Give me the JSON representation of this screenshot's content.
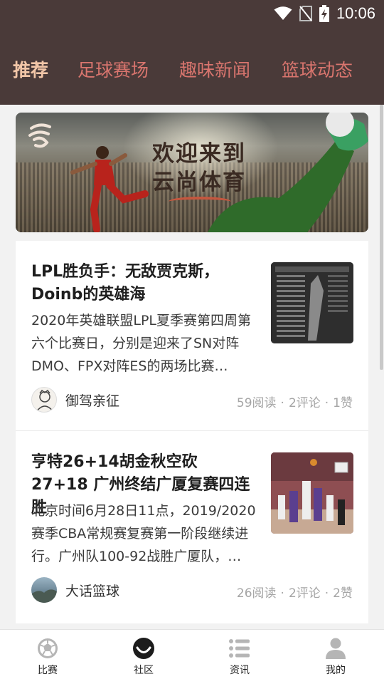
{
  "status": {
    "time": "10:06",
    "icons": [
      "wifi-icon",
      "no-sim-icon",
      "battery-charging-icon"
    ]
  },
  "tabs": [
    {
      "label": "推荐",
      "active": true
    },
    {
      "label": "足球赛场",
      "active": false
    },
    {
      "label": "趣味新闻",
      "active": false
    },
    {
      "label": "篮球动态",
      "active": false
    }
  ],
  "banner": {
    "line1": "欢迎来到",
    "line2": "云尚体育"
  },
  "articles": [
    {
      "title": "LPL胜负手：无敌贾克斯，Doinb的英雄海",
      "summary": "2020年英雄联盟LPL夏季赛第四周第六个比赛日，分别是迎来了SN对阵DMO、FPX对阵ES的两场比赛…",
      "author": "御驾亲征",
      "reads": "59阅读",
      "comments": "2评论",
      "likes": "1赞"
    },
    {
      "title": "亨特26+14胡金秋空砍27+18 广州终结广厦复赛四连胜",
      "summary": "北京时间6月28日11点，2019/2020赛季CBA常规赛复赛第一阶段继续进行。广州队100-92战胜广厦队，…",
      "author": "大话篮球",
      "reads": "26阅读",
      "comments": "2评论",
      "likes": "2赞"
    }
  ],
  "bottom_nav": [
    {
      "label": "比赛",
      "icon": "soccer-ball-icon",
      "active": false
    },
    {
      "label": "社区",
      "icon": "community-icon",
      "active": true
    },
    {
      "label": "资讯",
      "icon": "list-icon",
      "active": false
    },
    {
      "label": "我的",
      "icon": "user-icon",
      "active": false
    }
  ],
  "colors": {
    "header_bg": "#4a3a39",
    "tab_active": "#f2c6a8",
    "tab_inactive": "#d9756e",
    "stats_gray": "#a5a5a5"
  }
}
